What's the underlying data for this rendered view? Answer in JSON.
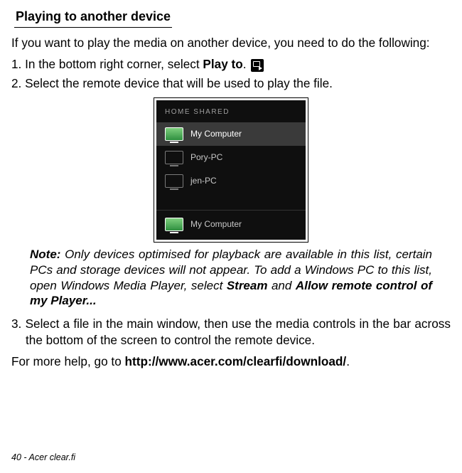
{
  "section_title": "Playing to another device",
  "intro": "If you want to play the media on another device, you need to do the following:",
  "step1_pre": "1. In the bottom right corner, select ",
  "step1_bold": "Play to",
  "step1_post": ". ",
  "step2": "2. Select the remote device that will be used to play the file.",
  "panel": {
    "header": "HOME SHARED",
    "devices": [
      "My Computer",
      "Pory-PC",
      "jen-PC"
    ],
    "bottom": "My Computer"
  },
  "note_label": "Note:",
  "note_body1": " Only devices optimised for playback are available in this list, certain PCs and storage devices will not appear. To add a Windows PC to this list, open Windows Media Player, select ",
  "note_b1": "Stream",
  "note_mid": " and ",
  "note_b2": "Allow remote control of my Player...",
  "step3": "3. Select a file in the main window, then use the media controls in the bar across the bottom of the screen to control the remote device.",
  "help_pre": "For more help, go to ",
  "help_url": "http://www.acer.com/clearfi/download/",
  "help_post": ".",
  "footer": "40 - Acer clear.fi"
}
